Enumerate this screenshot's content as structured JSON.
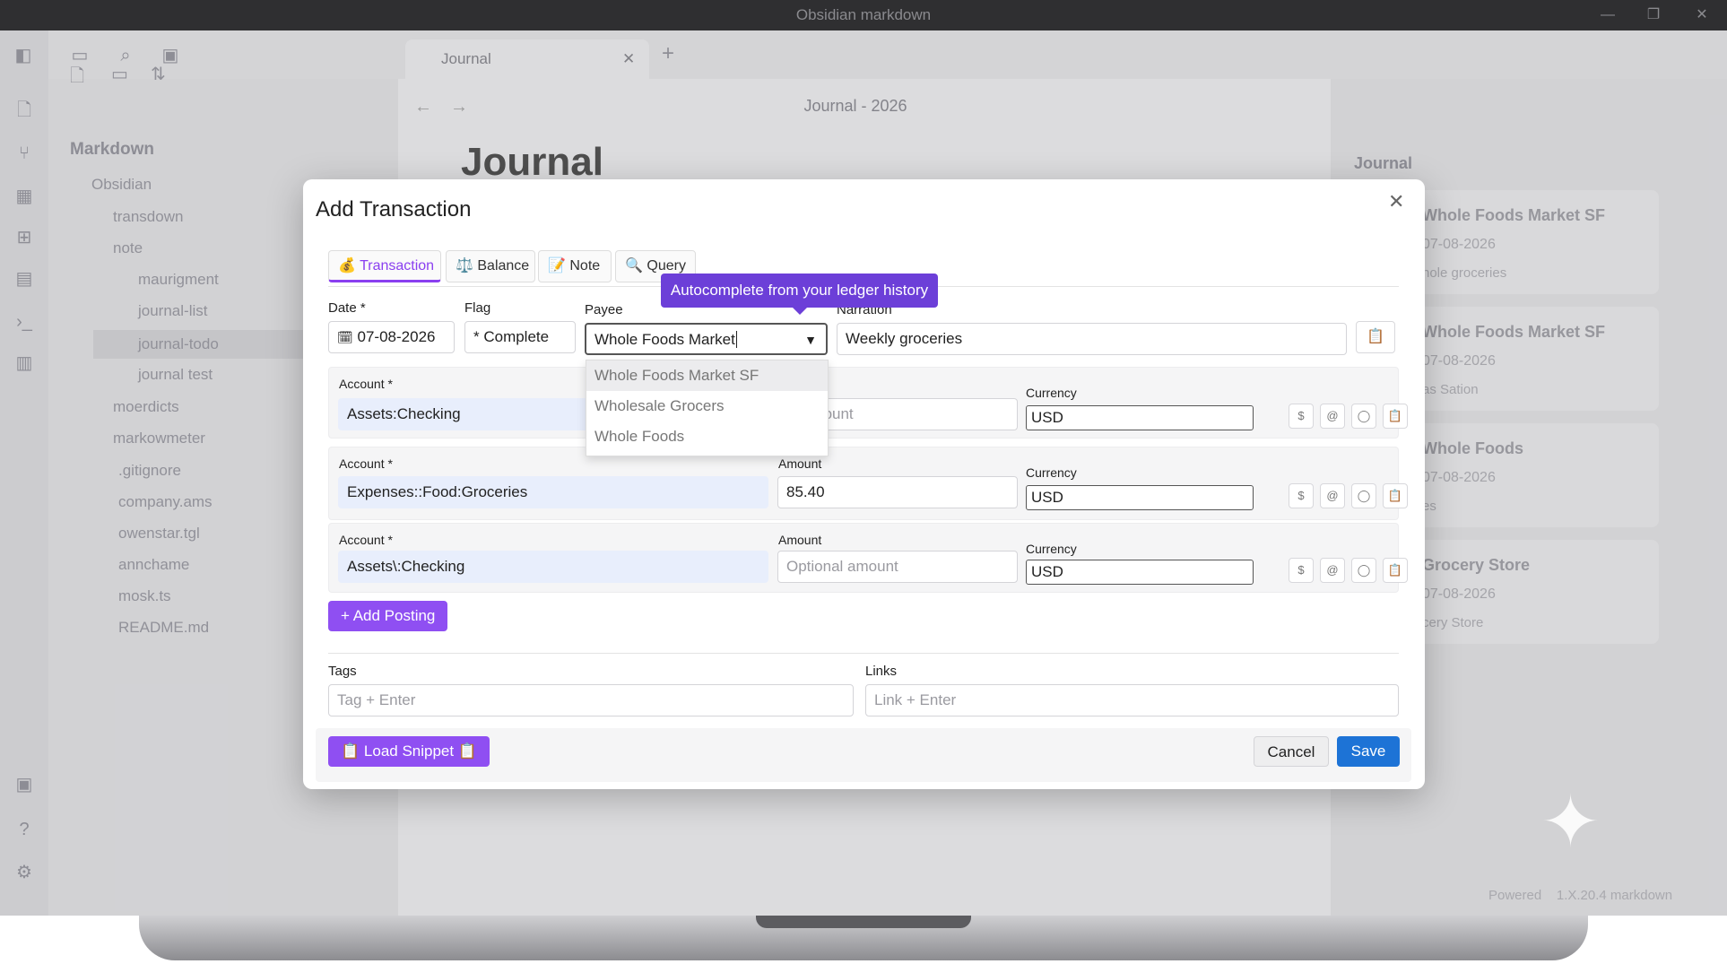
{
  "window": {
    "title": "Obsidian markdown",
    "minimize": "—",
    "maximize": "❐",
    "close": "✕"
  },
  "tab": {
    "label": "Journal",
    "close": "✕",
    "add": "+"
  },
  "note": {
    "breadcrumb": "Journal - 2026",
    "heading": "Journal"
  },
  "sidebar": {
    "vault": "Markdown",
    "items": [
      "Obsidian",
      "transdown",
      "note",
      "maurigment",
      "journal-list",
      "journal-todo",
      "journal test",
      "moerdicts",
      "markowmeter",
      ".gitignore",
      "company.ams",
      "owenstar.tgl",
      "annchame",
      "mosk.ts",
      "README.md"
    ]
  },
  "right_panel": {
    "title": "Journal",
    "cards": [
      {
        "title": "Whole Foods Market SF",
        "date": "07-08-2026",
        "sub": "hole groceries"
      },
      {
        "title": "Whole Foods Market SF",
        "date": "07-08-2026",
        "sub": "as Sation"
      },
      {
        "title": "Whole Foods",
        "date": "07-08-2026",
        "sub": "es"
      },
      {
        "title": "Grocery Store",
        "date": "07-08-2026",
        "sub": "cery Store"
      }
    ]
  },
  "status": {
    "left": "Powered",
    "right": "1.X.20.4 markdown"
  },
  "modal": {
    "title": "Add Transaction",
    "close": "✕",
    "tabs": [
      {
        "icon": "💰",
        "label": "Transaction"
      },
      {
        "icon": "⚖️",
        "label": "Balance"
      },
      {
        "icon": "📝",
        "label": "Note"
      },
      {
        "icon": "🔍",
        "label": "Query"
      }
    ],
    "tooltip": "Autocomplete from your ledger history",
    "date": {
      "label": "Date *",
      "value": "07-08-2026"
    },
    "flag": {
      "label": "Flag",
      "value": "* Complete"
    },
    "payee": {
      "label": "Payee",
      "value": "Whole Foods Market"
    },
    "narration": {
      "label": "Narration",
      "value": "Weekly groceries"
    },
    "payee_suggestions": [
      "Whole Foods Market SF",
      "Wholesale Grocers",
      "Whole Foods"
    ],
    "postings": [
      {
        "account_label": "Account *",
        "account": "Assets:Checking",
        "amount_label": "",
        "amount": "",
        "amount_placeholder": "al amount",
        "currency_label": "Currency",
        "currency": "USD"
      },
      {
        "account_label": "Account *",
        "account": "Expenses::Food:Groceries",
        "amount_label": "Amount",
        "amount": "85.40",
        "amount_placeholder": "",
        "currency_label": "Currency",
        "currency": "USD"
      },
      {
        "account_label": "Account *",
        "account": "Assets\\:Checking",
        "amount_label": "Amount",
        "amount": "",
        "amount_placeholder": "Optional amount",
        "currency_label": "Currency",
        "currency": "USD"
      }
    ],
    "posting_buttons": [
      "$",
      "@",
      "◯",
      "📋"
    ],
    "add_posting": "+ Add Posting",
    "tags": {
      "label": "Tags",
      "placeholder": "Tag + Enter"
    },
    "links": {
      "label": "Links",
      "placeholder": "Link + Enter"
    },
    "load_snippet": "Load Snippet",
    "cancel": "Cancel",
    "save": "Save"
  },
  "colors": {
    "accent": "#8f4ff2",
    "save": "#1d73d6",
    "tooltip": "#6c3fd8"
  }
}
